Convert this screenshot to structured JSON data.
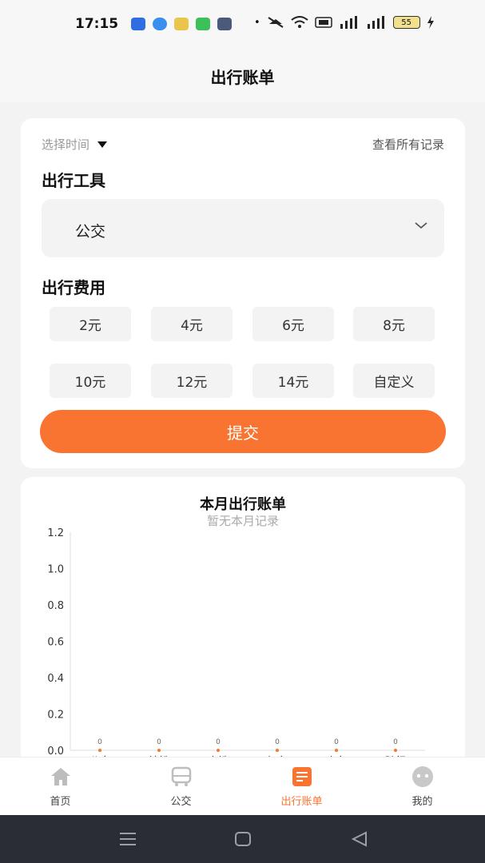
{
  "status_bar": {
    "time": "17:15",
    "battery": "55"
  },
  "header": {
    "title": "出行账单"
  },
  "form": {
    "select_time": "选择时间",
    "view_all": "查看所有记录",
    "tool_label": "出行工具",
    "tool_value": "公交",
    "fee_label": "出行费用",
    "fees": [
      "2元",
      "4元",
      "6元",
      "8元",
      "10元",
      "12元",
      "14元",
      "自定义"
    ],
    "submit": "提交"
  },
  "chart_data": {
    "type": "line",
    "title": "本月出行账单",
    "subtitle": "暂无本月记录",
    "categories": [
      "公交",
      "地铁",
      "高铁",
      "打车",
      "火车",
      "骑行"
    ],
    "series": [
      {
        "values": [
          0,
          0,
          0,
          0,
          0,
          0
        ]
      }
    ],
    "point_labels": [
      "0",
      "0",
      "0",
      "0",
      "0",
      "0"
    ],
    "y_ticks": [
      "0.0",
      "0.2",
      "0.4",
      "0.6",
      "0.8",
      "1.0",
      "1.2"
    ],
    "ylim": [
      0,
      1.2
    ],
    "grid": false
  },
  "bottom_nav": [
    {
      "label": "首页",
      "icon": "home-icon"
    },
    {
      "label": "公交",
      "icon": "bus-icon"
    },
    {
      "label": "出行账单",
      "icon": "bill-icon",
      "active": true
    },
    {
      "label": "我的",
      "icon": "profile-icon"
    }
  ],
  "colors": {
    "accent": "#f97430",
    "background": "#f3f3f3"
  }
}
